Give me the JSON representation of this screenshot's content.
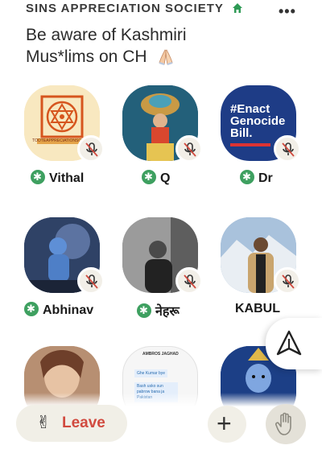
{
  "header": {
    "club_name": "SINS APPRECIATION SOCIETY",
    "room_title": "Be aware of Kashmiri Mus*lims on CH"
  },
  "speakers": [
    {
      "name": "Vithal",
      "moderator": true,
      "muted": true,
      "avatar_text": "TOOTEAPPRECIATIONSOCIETY"
    },
    {
      "name": "Q",
      "moderator": true,
      "muted": true
    },
    {
      "name": "Dr",
      "moderator": true,
      "muted": true,
      "avatar_text": "#Enact Genocide Bill."
    },
    {
      "name": "Abhinav",
      "moderator": true,
      "muted": true
    },
    {
      "name": "नेहरू",
      "moderator": true,
      "muted": true
    },
    {
      "name": "KABUL",
      "moderator": false,
      "muted": true
    }
  ],
  "partial_row": [
    {
      "avatar_text": "AMBROS JAGHAD"
    },
    {},
    {}
  ],
  "chat_preview": {
    "line1": "Ghe Kumar bye",
    "line2": "Bash usko sun pabrow bana ja Pakistan"
  },
  "controls": {
    "leave_label": "Leave",
    "add_label": "+"
  },
  "colors": {
    "moderator_badge": "#3ea060",
    "leave_text": "#d14a3f",
    "control_bg": "#f1efe7"
  },
  "icons": [
    "house-icon",
    "more-icon",
    "folded-hands-icon",
    "muted-mic-icon",
    "moderator-badge-icon",
    "share-icon",
    "victory-hand-icon",
    "plus-icon",
    "raised-hand-icon"
  ]
}
